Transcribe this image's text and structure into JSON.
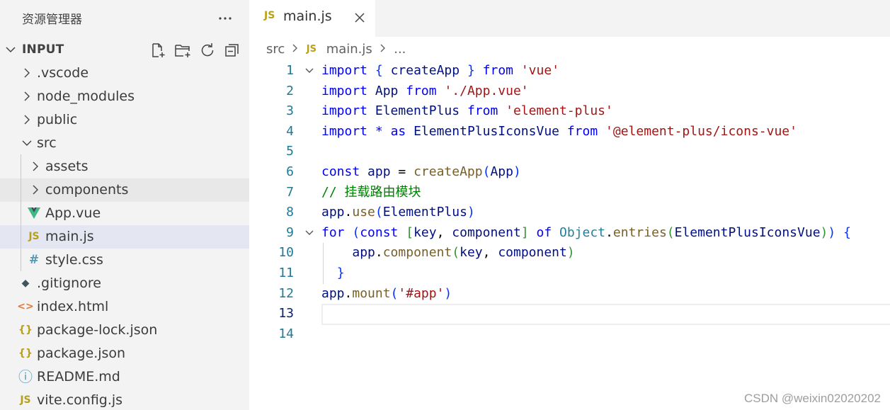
{
  "explorer": {
    "title": "资源管理器",
    "more_label": "···",
    "section_title": "INPUT",
    "actions": [
      {
        "name": "new-file-icon"
      },
      {
        "name": "new-folder-icon"
      },
      {
        "name": "refresh-icon"
      },
      {
        "name": "collapse-all-icon"
      }
    ],
    "tree": [
      {
        "label": ".vscode",
        "type": "folder",
        "depth": 0,
        "expanded": false
      },
      {
        "label": "node_modules",
        "type": "folder",
        "depth": 0,
        "expanded": false
      },
      {
        "label": "public",
        "type": "folder",
        "depth": 0,
        "expanded": false
      },
      {
        "label": "src",
        "type": "folder",
        "depth": 0,
        "expanded": true
      },
      {
        "label": "assets",
        "type": "folder",
        "depth": 1,
        "expanded": false
      },
      {
        "label": "components",
        "type": "folder",
        "depth": 1,
        "expanded": false,
        "hovered": true
      },
      {
        "label": "App.vue",
        "type": "file",
        "icon": "vue-icon",
        "glyph": "V",
        "icon_color": "#41b883",
        "depth": 1
      },
      {
        "label": "main.js",
        "type": "file",
        "icon": "js-icon",
        "glyph": "JS",
        "icon_color": "#b8a11a",
        "depth": 1,
        "selected": true
      },
      {
        "label": "style.css",
        "type": "file",
        "icon": "css-icon",
        "glyph": "#",
        "icon_color": "#519aba",
        "depth": 1
      },
      {
        "label": ".gitignore",
        "type": "file",
        "icon": "git-icon",
        "glyph": "◆",
        "icon_color": "#41535b",
        "depth": 0
      },
      {
        "label": "index.html",
        "type": "file",
        "icon": "html-icon",
        "glyph": "<>",
        "icon_color": "#e37933",
        "depth": 0
      },
      {
        "label": "package-lock.json",
        "type": "file",
        "icon": "json-icon",
        "glyph": "{}",
        "icon_color": "#b8a11a",
        "depth": 0
      },
      {
        "label": "package.json",
        "type": "file",
        "icon": "json-icon",
        "glyph": "{}",
        "icon_color": "#b8a11a",
        "depth": 0
      },
      {
        "label": "README.md",
        "type": "file",
        "icon": "info-icon",
        "glyph": "ⓘ",
        "icon_color": "#519aba",
        "depth": 0
      },
      {
        "label": "vite.config.js",
        "type": "file",
        "icon": "js-icon",
        "glyph": "JS",
        "icon_color": "#b8a11a",
        "depth": 0
      }
    ]
  },
  "editor": {
    "tab": {
      "icon_text": "JS",
      "label": "main.js"
    },
    "breadcrumb": {
      "folder": "src",
      "file_icon": "JS",
      "file": "main.js",
      "more": "..."
    },
    "current_line": 13,
    "lines": [
      {
        "n": "1",
        "fold": true,
        "tokens": [
          [
            "k",
            "import"
          ],
          [
            "",
            " "
          ],
          [
            "b1",
            "{"
          ],
          [
            "",
            " "
          ],
          [
            "v",
            "createApp"
          ],
          [
            "",
            " "
          ],
          [
            "b1",
            "}"
          ],
          [
            "",
            " "
          ],
          [
            "k",
            "from"
          ],
          [
            "",
            " "
          ],
          [
            "s",
            "'vue'"
          ]
        ]
      },
      {
        "n": "2",
        "tokens": [
          [
            "k",
            "import"
          ],
          [
            "",
            " "
          ],
          [
            "v",
            "App"
          ],
          [
            "",
            " "
          ],
          [
            "k",
            "from"
          ],
          [
            "",
            " "
          ],
          [
            "s",
            "'./App.vue'"
          ]
        ]
      },
      {
        "n": "3",
        "tokens": [
          [
            "k",
            "import"
          ],
          [
            "",
            " "
          ],
          [
            "v",
            "ElementPlus"
          ],
          [
            "",
            " "
          ],
          [
            "k",
            "from"
          ],
          [
            "",
            " "
          ],
          [
            "s",
            "'element-plus'"
          ]
        ]
      },
      {
        "n": "4",
        "tokens": [
          [
            "k",
            "import"
          ],
          [
            "",
            " "
          ],
          [
            "k",
            "*"
          ],
          [
            "",
            " "
          ],
          [
            "k",
            "as"
          ],
          [
            "",
            " "
          ],
          [
            "v",
            "ElementPlusIconsVue"
          ],
          [
            "",
            " "
          ],
          [
            "k",
            "from"
          ],
          [
            "",
            " "
          ],
          [
            "s",
            "'@element-plus/icons-vue'"
          ]
        ]
      },
      {
        "n": "5",
        "tokens": []
      },
      {
        "n": "6",
        "tokens": [
          [
            "k",
            "const"
          ],
          [
            "",
            " "
          ],
          [
            "v",
            "app"
          ],
          [
            "",
            " = "
          ],
          [
            "f",
            "createApp"
          ],
          [
            "b1",
            "("
          ],
          [
            "v",
            "App"
          ],
          [
            "b1",
            ")"
          ]
        ]
      },
      {
        "n": "7",
        "tokens": [
          [
            "c",
            "// 挂载路由模块"
          ]
        ]
      },
      {
        "n": "8",
        "tokens": [
          [
            "v",
            "app"
          ],
          [
            "",
            "."
          ],
          [
            "f",
            "use"
          ],
          [
            "b1",
            "("
          ],
          [
            "v",
            "ElementPlus"
          ],
          [
            "b1",
            ")"
          ]
        ]
      },
      {
        "n": "9",
        "fold": true,
        "tokens": [
          [
            "k",
            "for"
          ],
          [
            "",
            " "
          ],
          [
            "b1",
            "("
          ],
          [
            "k",
            "const"
          ],
          [
            "",
            " "
          ],
          [
            "b2",
            "["
          ],
          [
            "v",
            "key"
          ],
          [
            "",
            ", "
          ],
          [
            "v",
            "component"
          ],
          [
            "b2",
            "]"
          ],
          [
            "",
            " "
          ],
          [
            "k",
            "of"
          ],
          [
            "",
            " "
          ],
          [
            "t",
            "Object"
          ],
          [
            "",
            "."
          ],
          [
            "f",
            "entries"
          ],
          [
            "b2",
            "("
          ],
          [
            "v",
            "ElementPlusIconsVue"
          ],
          [
            "b2",
            ")"
          ],
          [
            "b1",
            ")"
          ],
          [
            "",
            " "
          ],
          [
            "b1",
            "{"
          ]
        ]
      },
      {
        "n": "10",
        "guide": true,
        "tokens": [
          [
            "",
            "    "
          ],
          [
            "v",
            "app"
          ],
          [
            "",
            "."
          ],
          [
            "f",
            "component"
          ],
          [
            "b2",
            "("
          ],
          [
            "v",
            "key"
          ],
          [
            "",
            ", "
          ],
          [
            "v",
            "component"
          ],
          [
            "b2",
            ")"
          ]
        ]
      },
      {
        "n": "11",
        "guide": true,
        "tokens": [
          [
            "",
            "  "
          ],
          [
            "b1",
            "}"
          ]
        ]
      },
      {
        "n": "12",
        "tokens": [
          [
            "v",
            "app"
          ],
          [
            "",
            "."
          ],
          [
            "f",
            "mount"
          ],
          [
            "b1",
            "("
          ],
          [
            "s",
            "'#app'"
          ],
          [
            "b1",
            ")"
          ]
        ]
      },
      {
        "n": "13",
        "tokens": []
      },
      {
        "n": "14",
        "tokens": []
      }
    ]
  },
  "watermark": "CSDN @weixin02020202",
  "colors": {
    "sidebar_bg": "#f3f3f3",
    "selected_bg": "#e4e6f1",
    "hover_bg": "#e8e8e8",
    "keyword": "#0000ff",
    "string": "#a31515",
    "function": "#795e26",
    "variable": "#001080",
    "comment": "#008000",
    "line_number": "#237893"
  }
}
